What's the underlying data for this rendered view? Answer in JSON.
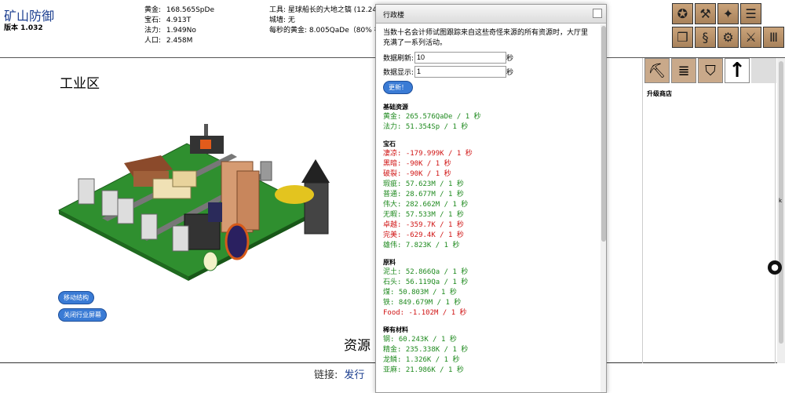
{
  "header": {
    "title": "矿山防御",
    "version": "版本 1.032",
    "stats_left": [
      {
        "label": "黄金:",
        "value": "168.565SpDe"
      },
      {
        "label": "宝石:",
        "value": "4.913T"
      },
      {
        "label": "法力:",
        "value": "1.949No"
      },
      {
        "label": "人口:",
        "value": "2.458M"
      }
    ],
    "stats_right": [
      {
        "label": "工具:",
        "value": "星球船长的大地之镐 (12.249G"
      },
      {
        "label": "城墙:",
        "value": "无"
      },
      {
        "label": "每秒的黄金:",
        "value": "8.005QaDe（80% 被"
      }
    ]
  },
  "icons": {
    "tools": [
      "seal-icon",
      "anvil-icon",
      "wand-icon",
      "stack-icon",
      "book-icon",
      "dragon-icon",
      "gear-icon",
      "swords-icon",
      "columns-icon"
    ],
    "shop_tabs": [
      "pickaxe-icon",
      "scroll-icon",
      "shield-icon",
      "up-arrow-icon"
    ]
  },
  "main": {
    "section_title": "工业区",
    "move_structure": "移动结构",
    "close_industry": "关闭行业屏幕",
    "resource_heading": "资源"
  },
  "shop": {
    "title": "升级商店",
    "side_label": "k"
  },
  "footer": {
    "label": "链接:",
    "link": "发行"
  },
  "dialog": {
    "title": "行政楼",
    "description": "当数十名会计师试图跟踪来自这些奇怪来源的所有资源时，大厅里充满了一系列活动。",
    "refresh_label": "数据刷新:",
    "refresh_value": "10",
    "refresh_unit": "秒",
    "display_label": "数据显示:",
    "display_value": "1",
    "display_unit": "秒",
    "update_button": "更新！",
    "groups": [
      {
        "title": "基础资源",
        "items": [
          {
            "text": "黄金: 265.576QaDe / 1 秒",
            "sign": "pos"
          },
          {
            "text": "法力: 51.354Sp / 1 秒",
            "sign": "pos"
          }
        ]
      },
      {
        "title": "宝石",
        "items": [
          {
            "text": "凄凉: -179.999K / 1 秒",
            "sign": "neg"
          },
          {
            "text": "黑暗: -90K / 1 秒",
            "sign": "neg"
          },
          {
            "text": "破裂: -90K / 1 秒",
            "sign": "neg"
          },
          {
            "text": "瑕疵: 57.623M / 1 秒",
            "sign": "pos"
          },
          {
            "text": "普通: 28.677M / 1 秒",
            "sign": "pos"
          },
          {
            "text": "伟大: 282.662M / 1 秒",
            "sign": "pos"
          },
          {
            "text": "无暇: 57.533M / 1 秒",
            "sign": "pos"
          },
          {
            "text": "卓越: -359.7K / 1 秒",
            "sign": "neg"
          },
          {
            "text": "完美: -629.4K / 1 秒",
            "sign": "neg"
          },
          {
            "text": "雄伟: 7.823K / 1 秒",
            "sign": "pos"
          }
        ]
      },
      {
        "title": "原料",
        "items": [
          {
            "text": "泥土: 52.866Qa / 1 秒",
            "sign": "pos"
          },
          {
            "text": "石头: 56.119Qa / 1 秒",
            "sign": "pos"
          },
          {
            "text": "煤: 50.803M / 1 秒",
            "sign": "pos"
          },
          {
            "text": "铁: 849.679M / 1 秒",
            "sign": "pos"
          },
          {
            "text": "Food: -1.102M / 1 秒",
            "sign": "neg"
          }
        ]
      },
      {
        "title": "稀有材料",
        "items": [
          {
            "text": "钢: 60.243K / 1 秒",
            "sign": "pos"
          },
          {
            "text": "精金: 235.338K / 1 秒",
            "sign": "pos"
          },
          {
            "text": "龙鳞: 1.326K / 1 秒",
            "sign": "pos"
          },
          {
            "text": "亚麻: 21.986K / 1 秒",
            "sign": "pos"
          }
        ]
      }
    ]
  }
}
